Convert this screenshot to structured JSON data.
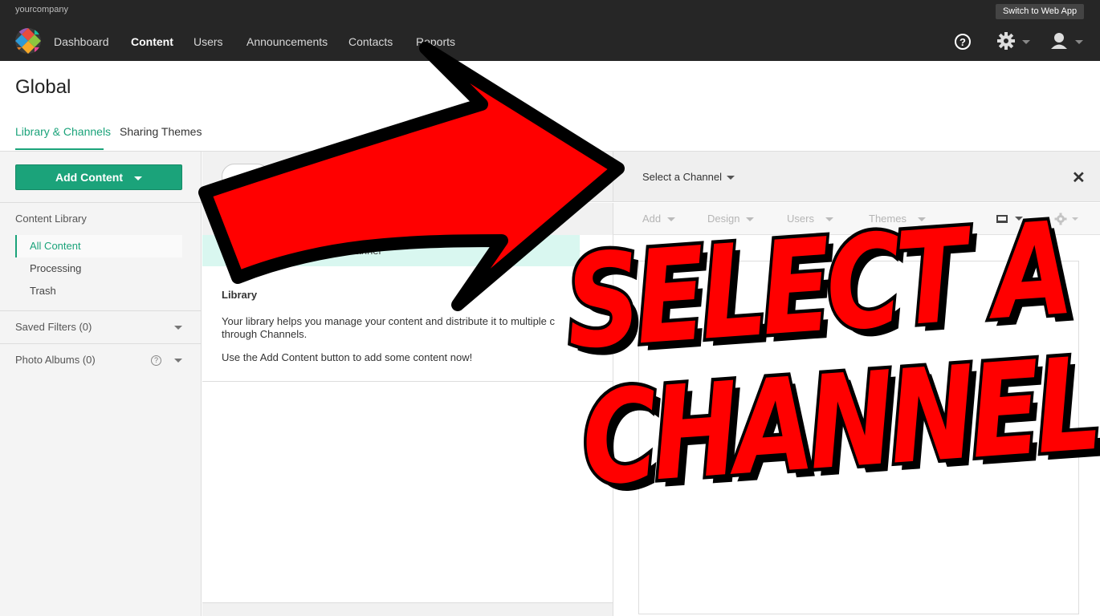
{
  "topbar": {
    "company": "yourcompany",
    "switch_label": "Switch to Web App",
    "nav": [
      "Dashboard",
      "Content",
      "Users",
      "Announcements",
      "Contacts",
      "Reports"
    ]
  },
  "page": {
    "title": "Global",
    "tabs": [
      "Library & Channels",
      "Sharing Themes"
    ]
  },
  "sidebar": {
    "add_content": "Add Content",
    "library_heading": "Content Library",
    "items": [
      "All Content",
      "Processing",
      "Trash"
    ],
    "saved_filters": "Saved Filters (0)",
    "photo_albums": "Photo Albums (0)"
  },
  "middle": {
    "breadcrumb": "Channel",
    "library_title": "Library",
    "text1": "Your library helps you manage your content and distribute it to multiple c",
    "text1b": "through Channels.",
    "text2": "Use the Add Content button to add some content now!"
  },
  "right": {
    "select_channel": "Select a Channel",
    "close": "✕",
    "tabs": [
      "Add",
      "Design",
      "Users",
      "Themes"
    ]
  },
  "overlay": {
    "line1": "SELECT A",
    "line2": "CHANNEL"
  },
  "colors": {
    "accent": "#1ba37a",
    "topbar": "#262626",
    "arrow": "#ff0000"
  }
}
